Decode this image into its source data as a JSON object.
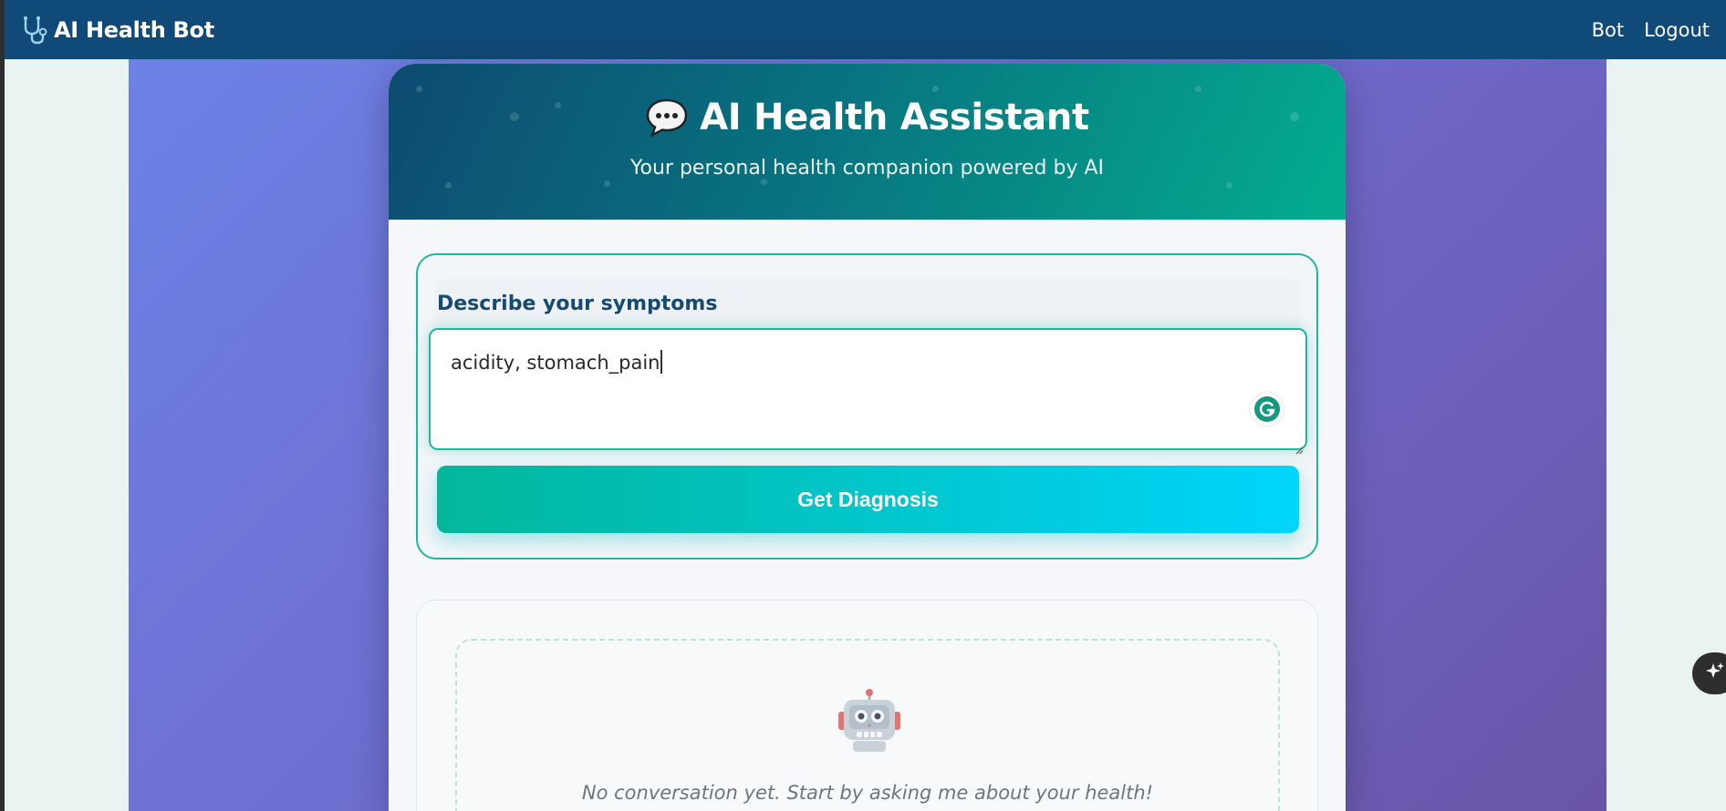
{
  "navbar": {
    "brand": "AI Health Bot",
    "brand_icon": "stethoscope-icon",
    "links": [
      "Bot",
      "Logout"
    ]
  },
  "card": {
    "title": "AI Health Assistant",
    "title_icon": "speech-bubble-icon",
    "subtitle": "Your personal health companion powered by AI"
  },
  "form": {
    "label": "Describe your symptoms",
    "textarea_value": "acidity, stomach_pain",
    "button_label": "Get Diagnosis"
  },
  "conversation": {
    "empty_icon": "robot-icon",
    "empty_text": "No conversation yet. Start by asking me about your health!"
  },
  "colors": {
    "navbar": "#0f4a78",
    "accent": "#1fb89e",
    "button_gradient_start": "#03b79b",
    "button_gradient_end": "#00d5fb",
    "hero_gradient_start": "#6d82e6",
    "hero_gradient_end": "#6a55a8"
  }
}
